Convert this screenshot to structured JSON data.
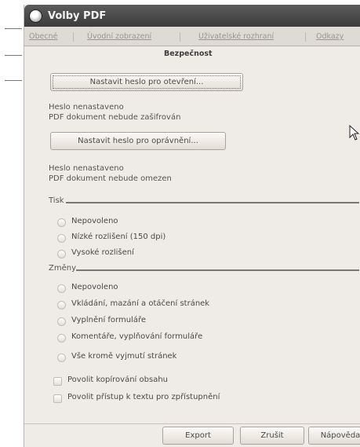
{
  "window": {
    "title": "Volby PDF"
  },
  "tabs": [
    {
      "label": "Obecné"
    },
    {
      "label": "Úvodní zobrazení"
    },
    {
      "label": "Uživatelské rozhraní"
    },
    {
      "label": "Odkazy"
    },
    {
      "label": "Bezpečnost"
    }
  ],
  "security": {
    "open_password_button": "Nastavit heslo pro otevření...",
    "open_status_line1": "Heslo nenastaveno",
    "open_status_line2": "PDF dokument nebude zašifrován",
    "permission_password_button": "Nastavit heslo pro oprávnění...",
    "permission_status_line1": "Heslo nenastaveno",
    "permission_status_line2": "PDF dokument nebude omezen"
  },
  "printing": {
    "label": "Tisk",
    "options": [
      "Nepovoleno",
      "Nízké rozlišení (150 dpi)",
      "Vysoké rozlišení"
    ]
  },
  "changes": {
    "label": "Změny",
    "options": [
      "Nepovoleno",
      "Vkládání, mazání a otáčení stránek",
      "Vyplnění formuláře",
      "Komentáře, vyplňování formuláře",
      "Vše kromě vyjmutí stránek"
    ]
  },
  "checkboxes": {
    "copy_content": "Povolit kopírování obsahu",
    "text_access": "Povolit přístup k textu pro zpřístupnění"
  },
  "buttons": {
    "export": "Export",
    "cancel": "Zrušit",
    "help": "Nápověda"
  }
}
